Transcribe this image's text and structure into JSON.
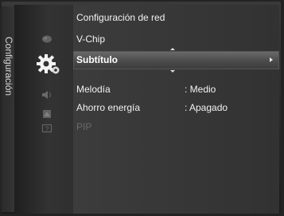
{
  "side_label": "Configuración",
  "icons": [
    "picture-icon",
    "gear-icon",
    "sound-icon",
    "channel-icon",
    "input-icon",
    "help-icon"
  ],
  "menu": {
    "items": [
      {
        "label": "Configuración de red",
        "value": ""
      },
      {
        "label": "V-Chip",
        "value": ""
      },
      {
        "label": "Subtítulo",
        "value": "",
        "selected": true
      },
      {
        "label": "Melodía",
        "value": ": Medio"
      },
      {
        "label": "Ahorro energía",
        "value": ": Apagado"
      },
      {
        "label": "PIP",
        "value": "",
        "disabled": true
      }
    ]
  },
  "colors": {
    "selected_bg": "#5a5a5a",
    "text": "#f2f2f2",
    "disabled_text": "#6a6a6a"
  }
}
